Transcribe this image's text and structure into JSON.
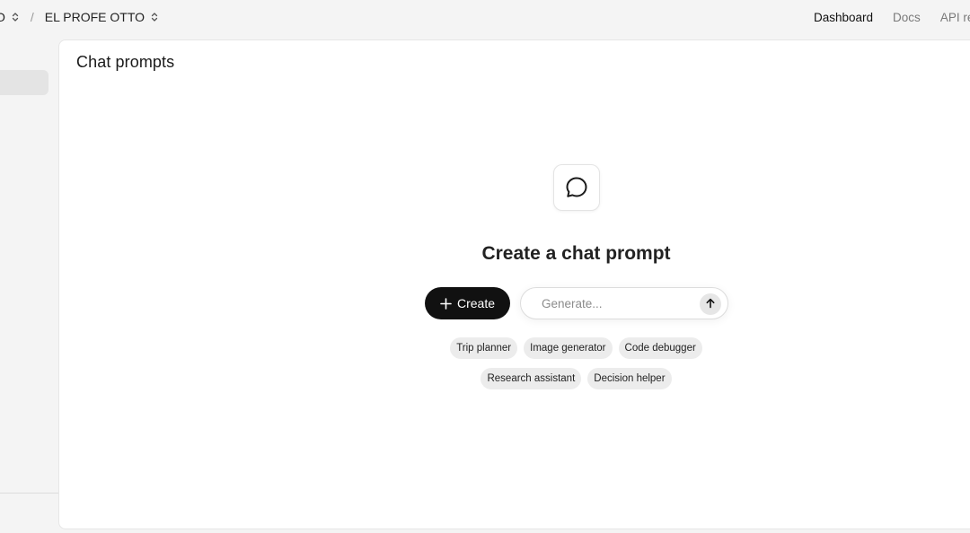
{
  "breadcrumb": {
    "org": "O",
    "separator": "/",
    "project": "EL PROFE OTTO"
  },
  "nav": {
    "items": [
      {
        "label": "Dashboard",
        "active": true
      },
      {
        "label": "Docs",
        "active": false
      },
      {
        "label": "API reference",
        "active": false
      }
    ]
  },
  "main": {
    "title": "Chat prompts",
    "empty_state": {
      "icon": "chat-bubble-icon",
      "heading": "Create a chat prompt",
      "create_label": "Create",
      "generate_placeholder": "Generate...",
      "suggestions_row1": [
        "Trip planner",
        "Image generator",
        "Code debugger"
      ],
      "suggestions_row2": [
        "Research assistant",
        "Decision helper"
      ]
    }
  },
  "colors": {
    "primary_button": "#111111",
    "background": "#f4f4f4",
    "chip": "#ececec"
  }
}
